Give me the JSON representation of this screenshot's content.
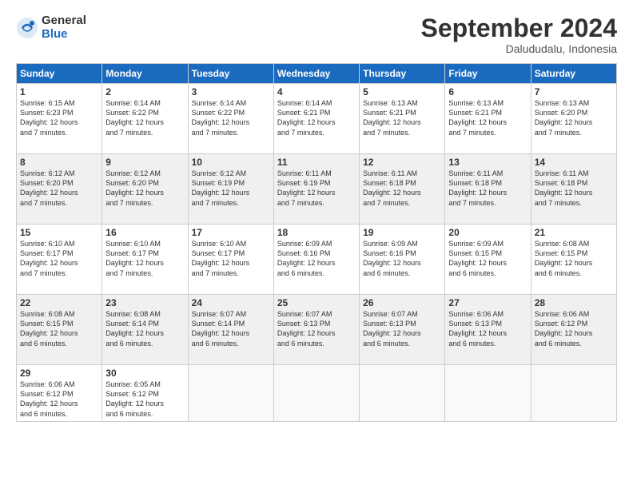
{
  "logo": {
    "general": "General",
    "blue": "Blue"
  },
  "header": {
    "month": "September 2024",
    "location": "Dalududalu, Indonesia"
  },
  "days_of_week": [
    "Sunday",
    "Monday",
    "Tuesday",
    "Wednesday",
    "Thursday",
    "Friday",
    "Saturday"
  ],
  "weeks": [
    [
      {
        "day": "1",
        "info": "Sunrise: 6:15 AM\nSunset: 6:23 PM\nDaylight: 12 hours\nand 7 minutes."
      },
      {
        "day": "2",
        "info": "Sunrise: 6:14 AM\nSunset: 6:22 PM\nDaylight: 12 hours\nand 7 minutes."
      },
      {
        "day": "3",
        "info": "Sunrise: 6:14 AM\nSunset: 6:22 PM\nDaylight: 12 hours\nand 7 minutes."
      },
      {
        "day": "4",
        "info": "Sunrise: 6:14 AM\nSunset: 6:21 PM\nDaylight: 12 hours\nand 7 minutes."
      },
      {
        "day": "5",
        "info": "Sunrise: 6:13 AM\nSunset: 6:21 PM\nDaylight: 12 hours\nand 7 minutes."
      },
      {
        "day": "6",
        "info": "Sunrise: 6:13 AM\nSunset: 6:21 PM\nDaylight: 12 hours\nand 7 minutes."
      },
      {
        "day": "7",
        "info": "Sunrise: 6:13 AM\nSunset: 6:20 PM\nDaylight: 12 hours\nand 7 minutes."
      }
    ],
    [
      {
        "day": "8",
        "info": "Sunrise: 6:12 AM\nSunset: 6:20 PM\nDaylight: 12 hours\nand 7 minutes."
      },
      {
        "day": "9",
        "info": "Sunrise: 6:12 AM\nSunset: 6:20 PM\nDaylight: 12 hours\nand 7 minutes."
      },
      {
        "day": "10",
        "info": "Sunrise: 6:12 AM\nSunset: 6:19 PM\nDaylight: 12 hours\nand 7 minutes."
      },
      {
        "day": "11",
        "info": "Sunrise: 6:11 AM\nSunset: 6:19 PM\nDaylight: 12 hours\nand 7 minutes."
      },
      {
        "day": "12",
        "info": "Sunrise: 6:11 AM\nSunset: 6:18 PM\nDaylight: 12 hours\nand 7 minutes."
      },
      {
        "day": "13",
        "info": "Sunrise: 6:11 AM\nSunset: 6:18 PM\nDaylight: 12 hours\nand 7 minutes."
      },
      {
        "day": "14",
        "info": "Sunrise: 6:11 AM\nSunset: 6:18 PM\nDaylight: 12 hours\nand 7 minutes."
      }
    ],
    [
      {
        "day": "15",
        "info": "Sunrise: 6:10 AM\nSunset: 6:17 PM\nDaylight: 12 hours\nand 7 minutes."
      },
      {
        "day": "16",
        "info": "Sunrise: 6:10 AM\nSunset: 6:17 PM\nDaylight: 12 hours\nand 7 minutes."
      },
      {
        "day": "17",
        "info": "Sunrise: 6:10 AM\nSunset: 6:17 PM\nDaylight: 12 hours\nand 7 minutes."
      },
      {
        "day": "18",
        "info": "Sunrise: 6:09 AM\nSunset: 6:16 PM\nDaylight: 12 hours\nand 6 minutes."
      },
      {
        "day": "19",
        "info": "Sunrise: 6:09 AM\nSunset: 6:16 PM\nDaylight: 12 hours\nand 6 minutes."
      },
      {
        "day": "20",
        "info": "Sunrise: 6:09 AM\nSunset: 6:15 PM\nDaylight: 12 hours\nand 6 minutes."
      },
      {
        "day": "21",
        "info": "Sunrise: 6:08 AM\nSunset: 6:15 PM\nDaylight: 12 hours\nand 6 minutes."
      }
    ],
    [
      {
        "day": "22",
        "info": "Sunrise: 6:08 AM\nSunset: 6:15 PM\nDaylight: 12 hours\nand 6 minutes."
      },
      {
        "day": "23",
        "info": "Sunrise: 6:08 AM\nSunset: 6:14 PM\nDaylight: 12 hours\nand 6 minutes."
      },
      {
        "day": "24",
        "info": "Sunrise: 6:07 AM\nSunset: 6:14 PM\nDaylight: 12 hours\nand 6 minutes."
      },
      {
        "day": "25",
        "info": "Sunrise: 6:07 AM\nSunset: 6:13 PM\nDaylight: 12 hours\nand 6 minutes."
      },
      {
        "day": "26",
        "info": "Sunrise: 6:07 AM\nSunset: 6:13 PM\nDaylight: 12 hours\nand 6 minutes."
      },
      {
        "day": "27",
        "info": "Sunrise: 6:06 AM\nSunset: 6:13 PM\nDaylight: 12 hours\nand 6 minutes."
      },
      {
        "day": "28",
        "info": "Sunrise: 6:06 AM\nSunset: 6:12 PM\nDaylight: 12 hours\nand 6 minutes."
      }
    ],
    [
      {
        "day": "29",
        "info": "Sunrise: 6:06 AM\nSunset: 6:12 PM\nDaylight: 12 hours\nand 6 minutes."
      },
      {
        "day": "30",
        "info": "Sunrise: 6:05 AM\nSunset: 6:12 PM\nDaylight: 12 hours\nand 6 minutes."
      },
      {
        "day": "",
        "info": ""
      },
      {
        "day": "",
        "info": ""
      },
      {
        "day": "",
        "info": ""
      },
      {
        "day": "",
        "info": ""
      },
      {
        "day": "",
        "info": ""
      }
    ]
  ]
}
